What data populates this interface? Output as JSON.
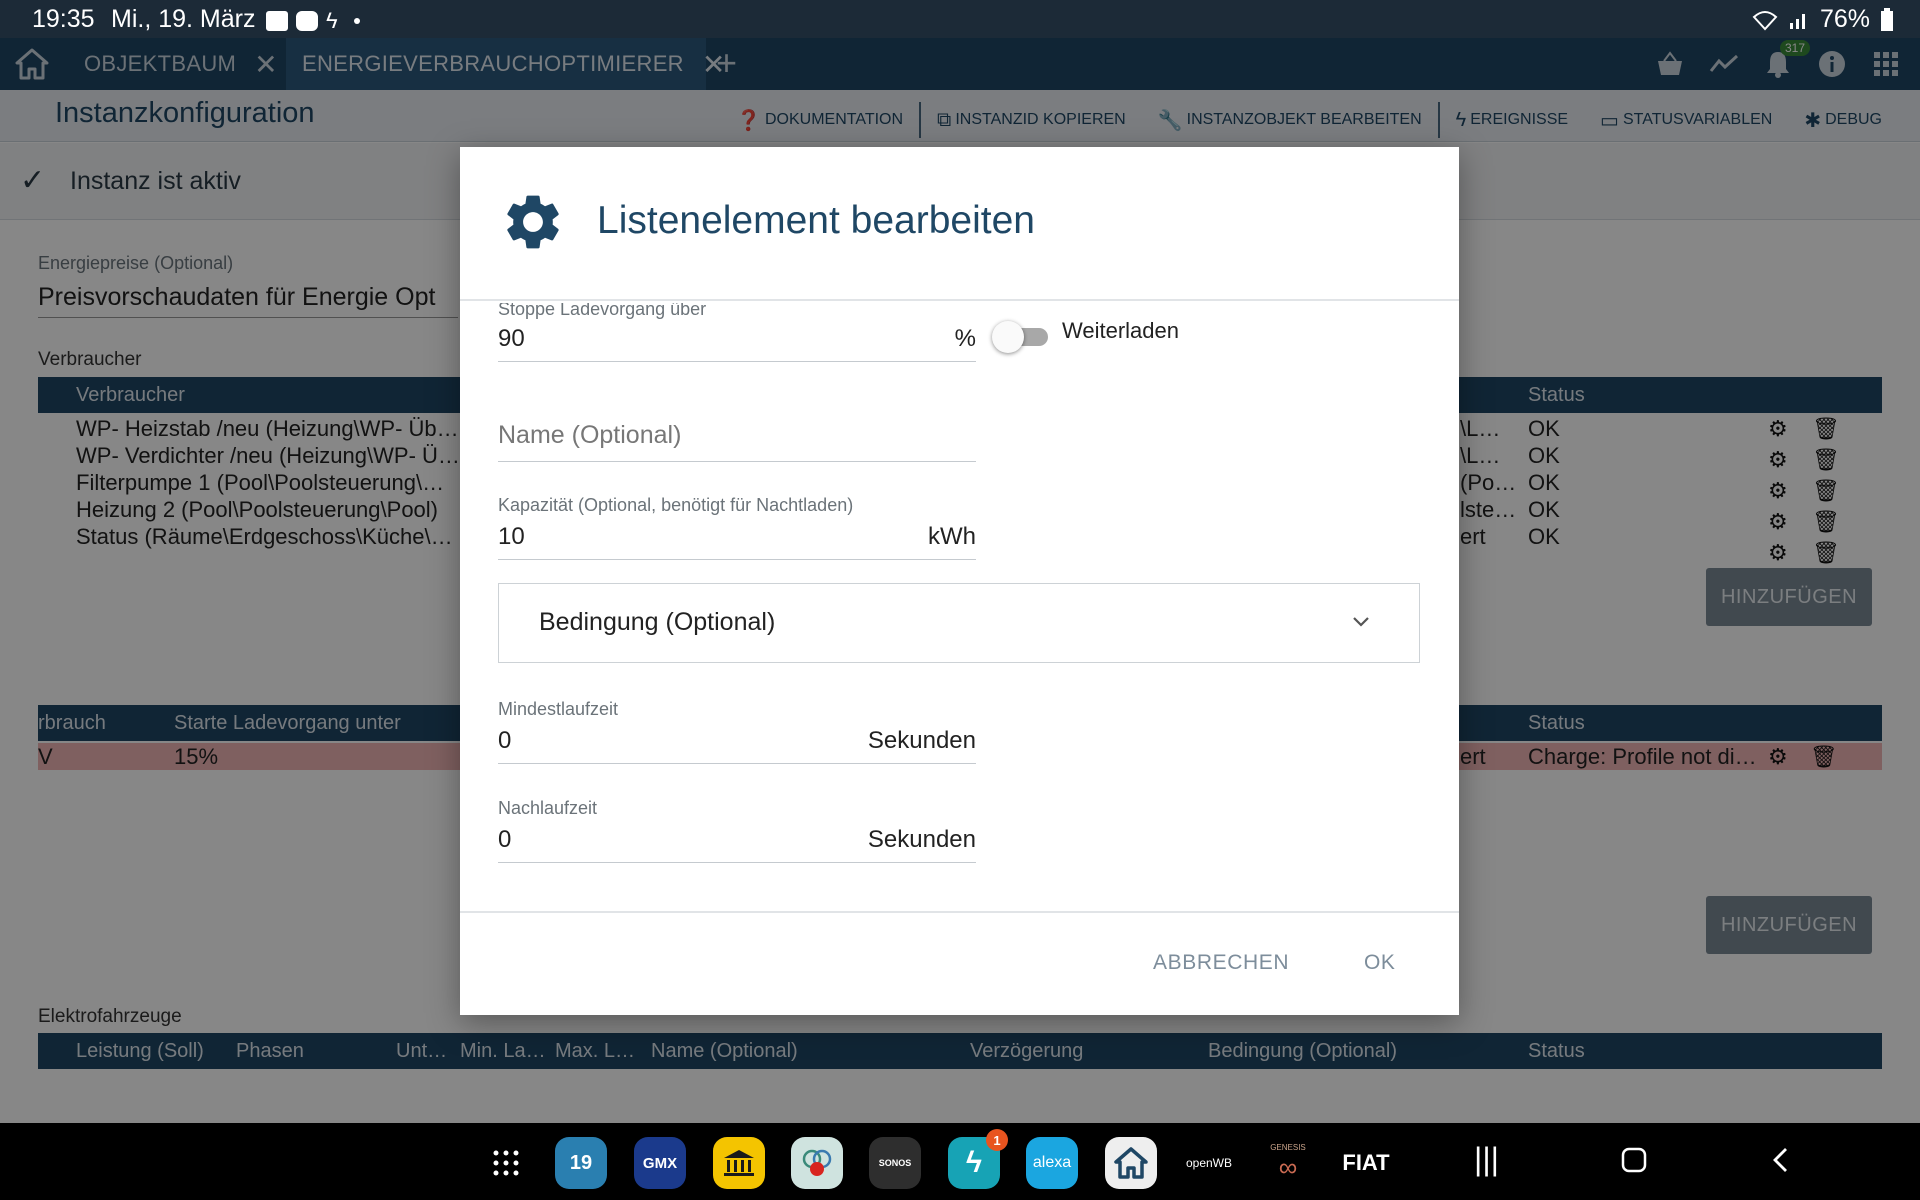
{
  "status_bar": {
    "time": "19:35",
    "date": "Mi., 19. März",
    "battery": "76%",
    "icons": [
      "image-icon",
      "youtube-icon",
      "bolt-icon",
      "dot-icon",
      "wifi-icon",
      "signal-icon",
      "battery-icon"
    ]
  },
  "tabs": [
    {
      "label": "OBJEKTBAUM",
      "active": false
    },
    {
      "label": "ENERGIEVERBRAUCHOPTIMIERER",
      "active": true
    }
  ],
  "topbar": {
    "notification_count": "317"
  },
  "toolbar": {
    "title": "Instanzkonfiguration",
    "actions": [
      {
        "icon": "help-icon",
        "label": "DOKUMENTATION"
      },
      {
        "icon": "copy-icon",
        "label": "INSTANZID KOPIEREN"
      },
      {
        "icon": "wrench-icon",
        "label": "INSTANZOBJEKT BEARBEITEN"
      },
      {
        "icon": "flash-icon",
        "label": "EREIGNISSE"
      },
      {
        "icon": "label-icon",
        "label": "STATUSVARIABLEN"
      },
      {
        "icon": "bug-icon",
        "label": "DEBUG"
      }
    ]
  },
  "background": {
    "active_text": "Instanz ist aktiv",
    "price_label": "Energiepreise (Optional)",
    "price_value": "Preisvorschaudaten für Energie Opt",
    "consumers_section": "Verbraucher",
    "consumers_header": {
      "col1": "Verbraucher",
      "status": "Status"
    },
    "consumers": [
      {
        "name": "WP- Heizstab /neu (Heizung\\WP- Üb…",
        "mid": "\\L…",
        "status": "OK"
      },
      {
        "name": "WP- Verdichter /neu (Heizung\\WP- Ü…",
        "mid": "\\L…",
        "status": "OK"
      },
      {
        "name": "Filterpumpe 1 (Pool\\Poolsteuerung\\…",
        "mid": "(Po…",
        "status": "OK"
      },
      {
        "name": "Heizung 2 (Pool\\Poolsteuerung\\Pool)",
        "mid": "lste…",
        "status": "OK"
      },
      {
        "name": "Status (Räume\\Erdgeschoss\\Küche\\…",
        "mid": "ert",
        "status": "OK"
      }
    ],
    "add_label": "HINZUFÜGEN",
    "battery_header": {
      "col1": "rbrauch",
      "col2": "Starte Ladevorgang unter",
      "status": "Status"
    },
    "battery_row": {
      "col1": "V",
      "col2": "15%",
      "mid": "ert",
      "status": "Charge: Profile not di…"
    },
    "ev_section": "Elektrofahrzeuge",
    "ev_header": [
      "Leistung (Soll)",
      "Phasen",
      "Unt…",
      "Min. La…",
      "Max. L…",
      "Name (Optional)",
      "Verzögerung",
      "Bedingung (Optional)",
      "Status"
    ]
  },
  "dialog": {
    "title": "Listenelement bearbeiten",
    "stop_label": "Stoppe Ladevorgang über",
    "stop_value": "90",
    "stop_unit": "%",
    "toggle_label": "Weiterladen",
    "toggle_on": false,
    "name_placeholder": "Name (Optional)",
    "capacity_label": "Kapazität (Optional, benötigt für Nachtladen)",
    "capacity_value": "10",
    "capacity_unit": "kWh",
    "condition_label": "Bedingung (Optional)",
    "min_runtime_label": "Mindestlaufzeit",
    "min_runtime_value": "0",
    "min_runtime_unit": "Sekunden",
    "after_runtime_label": "Nachlaufzeit",
    "after_runtime_value": "0",
    "after_runtime_unit": "Sekunden",
    "cancel_label": "ABBRECHEN",
    "ok_label": "OK"
  },
  "taskbar": {
    "apps": [
      {
        "name": "app-drawer",
        "text": ""
      },
      {
        "name": "calendar-app",
        "text": "19"
      },
      {
        "name": "gmx-app",
        "text": "GMX"
      },
      {
        "name": "bank-app",
        "text": ""
      },
      {
        "name": "photos-app",
        "text": ""
      },
      {
        "name": "sonos-app",
        "text": "SONOS"
      },
      {
        "name": "energy-app",
        "text": "1"
      },
      {
        "name": "alexa-app",
        "text": "alexa"
      },
      {
        "name": "home-app",
        "text": ""
      },
      {
        "name": "openwb-app",
        "text": "openWB"
      },
      {
        "name": "genesis-app",
        "text": "GENESIS"
      },
      {
        "name": "fiat-app",
        "text": "FIAT"
      }
    ]
  }
}
